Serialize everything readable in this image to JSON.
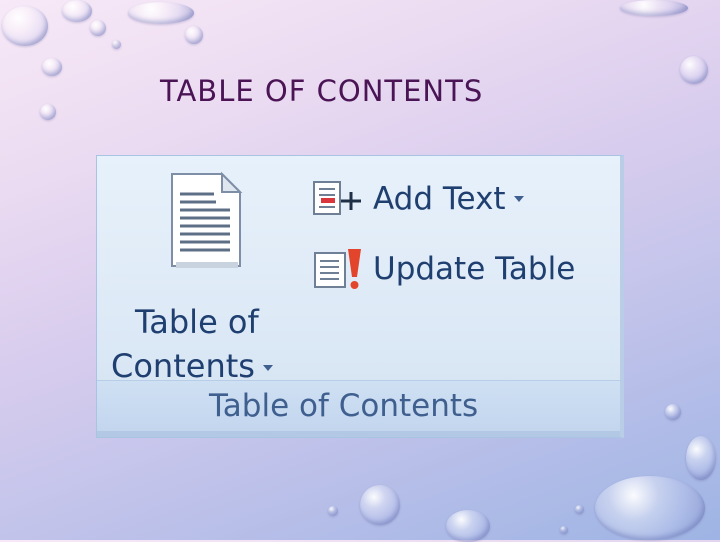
{
  "slide": {
    "title": "TABLE OF CONTENTS"
  },
  "ribbon_group": {
    "name": "Table of Contents",
    "toc_button": {
      "line1": "Table of",
      "line2": "Contents",
      "icon": "document-icon"
    },
    "add_text": {
      "label": "Add Text",
      "icon": "add-text-icon"
    },
    "update_table": {
      "label": "Update Table",
      "icon": "update-table-icon"
    }
  },
  "colors": {
    "ribbon_text": "#1f3f70",
    "group_label": "#3f5f8f",
    "title": "#4a1455"
  }
}
